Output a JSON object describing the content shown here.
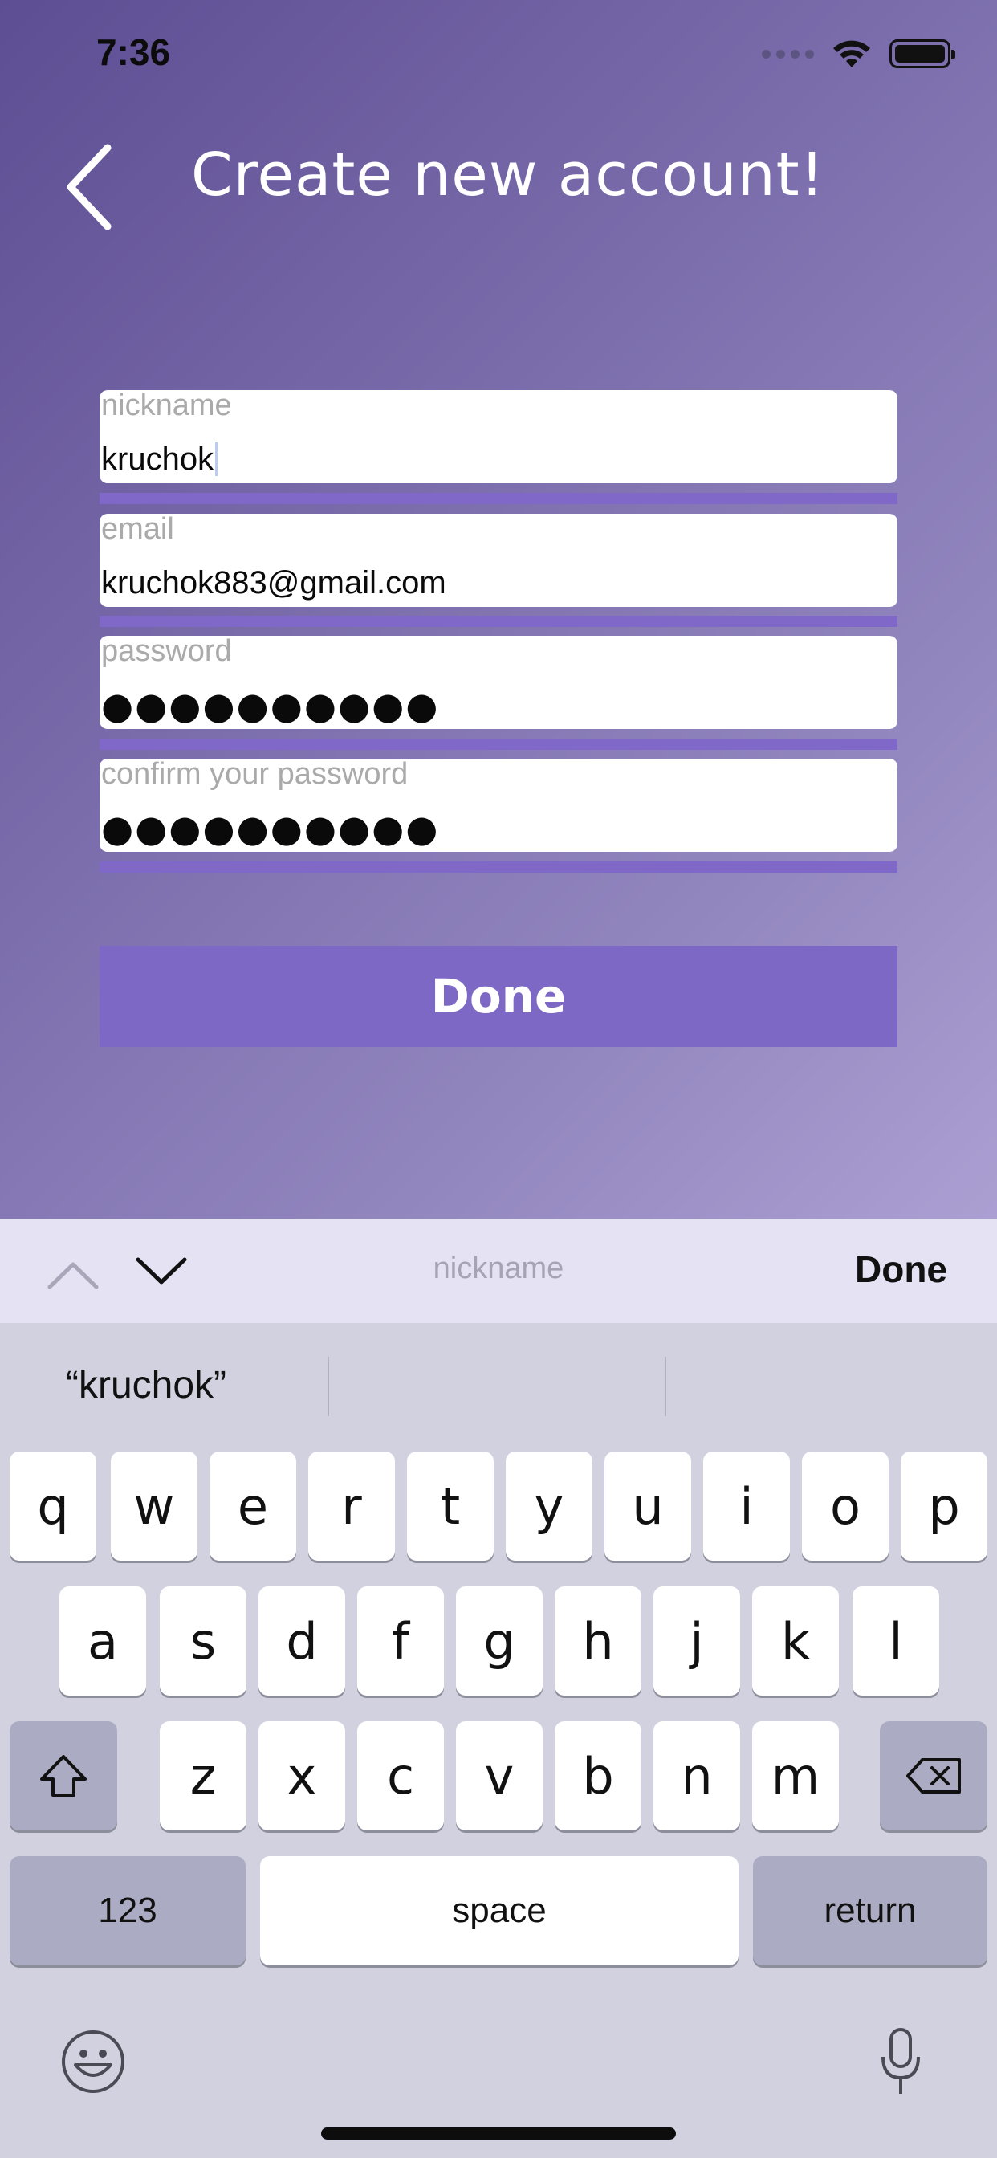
{
  "status_bar": {
    "time": "7:36"
  },
  "header": {
    "title": "Create new account!"
  },
  "form": {
    "fields": [
      {
        "placeholder": "nickname",
        "value": "kruchok"
      },
      {
        "placeholder": "email",
        "value": "kruchok883@gmail.com"
      },
      {
        "placeholder": "password",
        "value": "●●●●●●●●●●"
      },
      {
        "placeholder": "confirm your password",
        "value": "●●●●●●●●●●"
      }
    ],
    "done_label": "Done"
  },
  "keyboard_toolbar": {
    "field_label": "nickname",
    "done_label": "Done"
  },
  "keyboard": {
    "suggestion": "“kruchok”",
    "row1": [
      "q",
      "w",
      "e",
      "r",
      "t",
      "y",
      "u",
      "i",
      "o",
      "p"
    ],
    "row2": [
      "a",
      "s",
      "d",
      "f",
      "g",
      "h",
      "j",
      "k",
      "l"
    ],
    "row3": [
      "z",
      "x",
      "c",
      "v",
      "b",
      "n",
      "m"
    ],
    "numbers_label": "123",
    "space_label": "space",
    "return_label": "return"
  }
}
